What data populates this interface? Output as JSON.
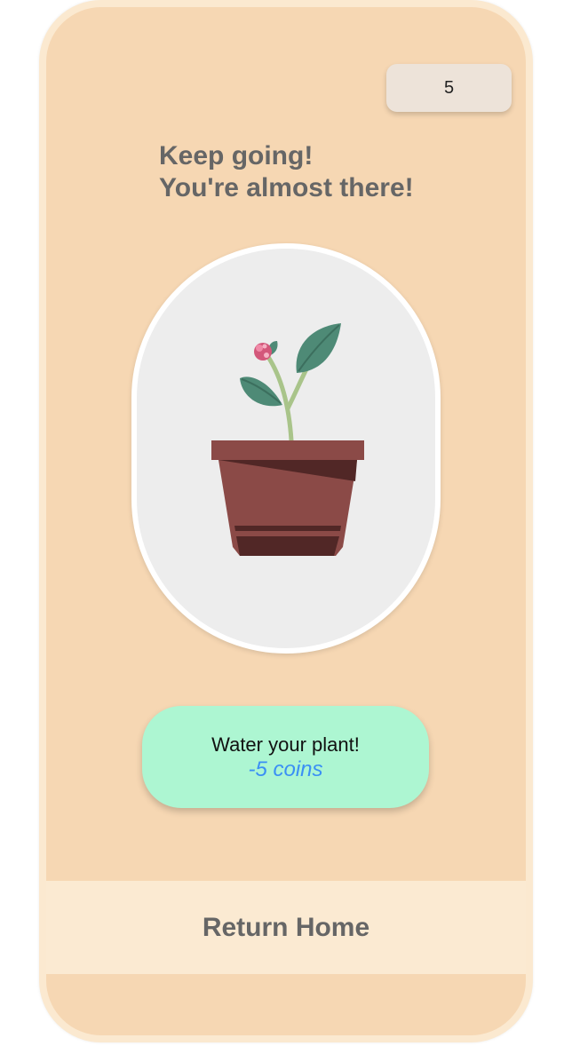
{
  "coins": {
    "count": "5"
  },
  "message": {
    "line1": "Keep going!",
    "line2": "You're almost there!"
  },
  "plant": {
    "icon": "potted-plant-icon",
    "colors": {
      "frame_background": "#ededed",
      "pot": "#8b4a47",
      "pot_shadow": "#512726",
      "leaf": "#4e8a76",
      "stem": "#a9c48a",
      "flower": "#d3577a"
    }
  },
  "water_button": {
    "label": "Water your plant!",
    "cost": "-5 coins"
  },
  "return_button": {
    "label": "Return Home"
  },
  "theme": {
    "background": "#f6d7b3",
    "frame_border": "#fbe9d0",
    "button_green": "#adf6d2",
    "cost_blue": "#3a8ff5",
    "text_gray": "#666666"
  }
}
